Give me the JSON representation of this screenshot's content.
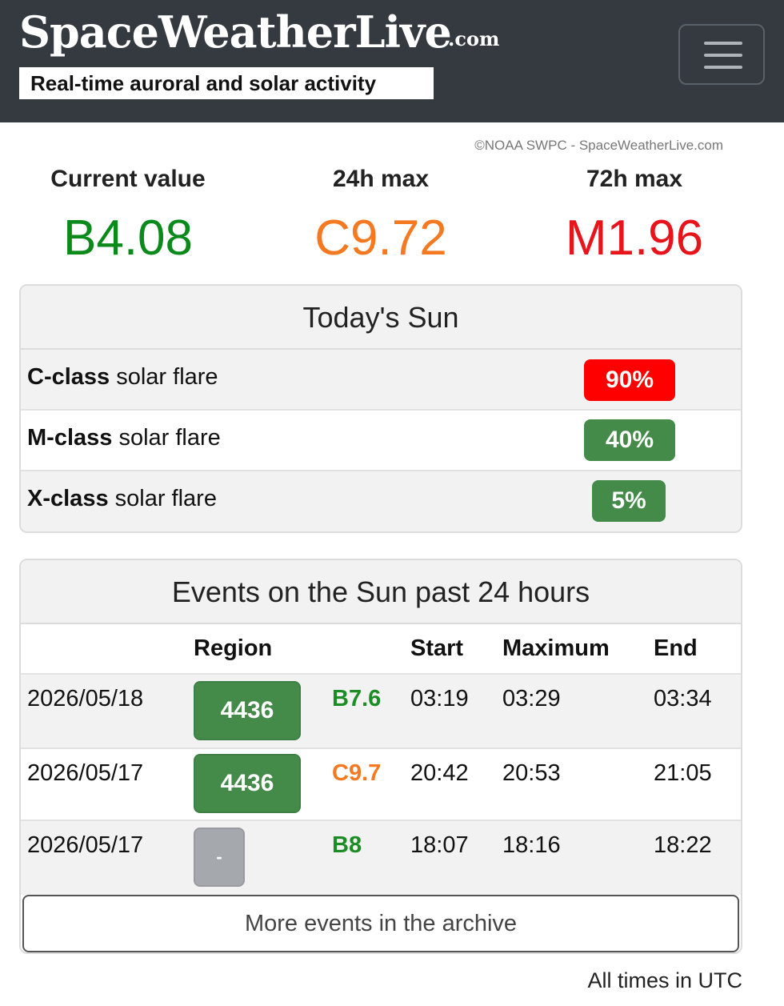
{
  "header": {
    "brand": "SpaceWeatherLive",
    "brand_tld": ".com",
    "tagline": "Real-time auroral and solar activity",
    "menu_icon": "hamburger-menu-icon"
  },
  "attribution": "©NOAA SWPC - SpaceWeatherLive.com",
  "stats": [
    {
      "label": "Current value",
      "value": "B4.08",
      "color": "#0b8a1c"
    },
    {
      "label": "24h max",
      "value": "C9.72",
      "color": "#f47920"
    },
    {
      "label": "72h max",
      "value": "M1.96",
      "color": "#e8141b"
    }
  ],
  "todays_sun": {
    "title": "Today's Sun",
    "rows": [
      {
        "class_bold": "C-class",
        "rest": " solar flare",
        "probability": "90%",
        "badge_color": "#ff0000"
      },
      {
        "class_bold": "M-class",
        "rest": " solar flare",
        "probability": "40%",
        "badge_color": "#448b4a"
      },
      {
        "class_bold": "X-class",
        "rest": " solar flare",
        "probability": "5%",
        "badge_color": "#448b4a"
      }
    ]
  },
  "events": {
    "title": "Events on the Sun past 24 hours",
    "columns": {
      "region": "Region",
      "start": "Start",
      "maximum": "Maximum",
      "end": "End"
    },
    "rows": [
      {
        "date": "2026/05/18",
        "region": "4436",
        "region_color": "#448b4a",
        "class": "B7.6",
        "class_color": "#1c8c24",
        "start": "03:19",
        "maximum": "03:29",
        "end": "03:34"
      },
      {
        "date": "2026/05/17",
        "region": "4436",
        "region_color": "#448b4a",
        "class": "C9.7",
        "class_color": "#f47920",
        "start": "20:42",
        "maximum": "20:53",
        "end": "21:05"
      },
      {
        "date": "2026/05/17",
        "region": "-",
        "region_color": "#a5a8ad",
        "class": "B8",
        "class_color": "#1c8c24",
        "start": "18:07",
        "maximum": "18:16",
        "end": "18:22"
      }
    ],
    "archive_button": "More events in the archive"
  },
  "footer_note": "All times in UTC"
}
